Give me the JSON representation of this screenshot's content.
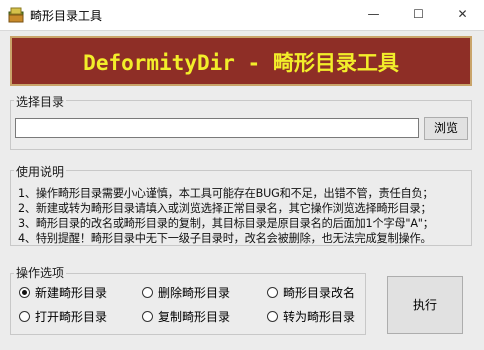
{
  "window": {
    "title": "畸形目录工具",
    "minimize_glyph": "—",
    "maximize_glyph": "☐",
    "close_glyph": "✕"
  },
  "banner": {
    "text": "DeformityDir - 畸形目录工具"
  },
  "select_dir": {
    "group_label": "选择目录",
    "path_value": "",
    "browse_label": "浏览"
  },
  "instructions": {
    "group_label": "使用说明",
    "lines": [
      "1、操作畸形目录需要小心谨慎，本工具可能存在BUG和不足，出错不管，责任自负；",
      "2、新建或转为畸形目录请填入或浏览选择正常目录名，其它操作浏览选择畸形目录；",
      "3、畸形目录的改名或畸形目录的复制，其目标目录是原目录名的后面加1个字母\"A\"；",
      "4、特别提醒！畸形目录中无下一级子目录时，改名会被删除，也无法完成复制操作。"
    ]
  },
  "options": {
    "group_label": "操作选项",
    "items": [
      {
        "label": "新建畸形目录",
        "selected": true
      },
      {
        "label": "删除畸形目录",
        "selected": false
      },
      {
        "label": "畸形目录改名",
        "selected": false
      },
      {
        "label": "打开畸形目录",
        "selected": false
      },
      {
        "label": "复制畸形目录",
        "selected": false
      },
      {
        "label": "转为畸形目录",
        "selected": false
      }
    ],
    "execute_label": "执行"
  },
  "colors": {
    "banner_bg": "#8e2e26",
    "banner_text": "#f2ee2a",
    "banner_border": "#c9a46a"
  },
  "icons": {
    "app": "app-folder-icon"
  }
}
